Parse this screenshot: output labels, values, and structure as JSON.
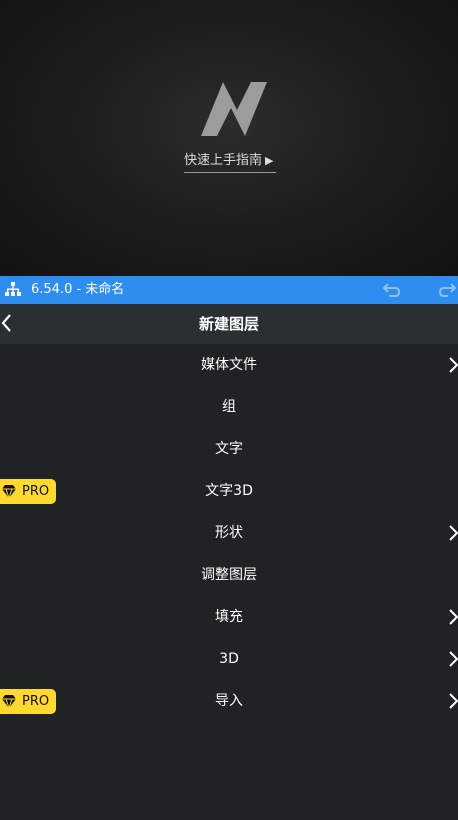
{
  "preview": {
    "logo_icon": "lightning-n-logo",
    "guide_text": "快速上手指南",
    "guide_arrow": "▶"
  },
  "statusbar": {
    "version_title": "6.54.0 - 未命名",
    "tree_icon": "hierarchy-icon",
    "undo_icon": "undo-icon",
    "redo_icon": "redo-icon",
    "background_color": "#2d8ef0"
  },
  "header": {
    "back_icon": "chevron-left-icon",
    "title": "新建图层"
  },
  "menu": {
    "items": [
      {
        "label": "媒体文件",
        "pro": false,
        "has_submenu": true
      },
      {
        "label": "组",
        "pro": false,
        "has_submenu": false
      },
      {
        "label": "文字",
        "pro": false,
        "has_submenu": false
      },
      {
        "label": "文字3D",
        "pro": true,
        "has_submenu": false
      },
      {
        "label": "形状",
        "pro": false,
        "has_submenu": true
      },
      {
        "label": "调整图层",
        "pro": false,
        "has_submenu": false
      },
      {
        "label": "填充",
        "pro": false,
        "has_submenu": true
      },
      {
        "label": "3D",
        "pro": false,
        "has_submenu": true
      },
      {
        "label": "导入",
        "pro": true,
        "has_submenu": true
      }
    ],
    "pro_badge": {
      "text": "PRO",
      "icon": "diamond-icon",
      "color": "#ffd92e"
    }
  }
}
